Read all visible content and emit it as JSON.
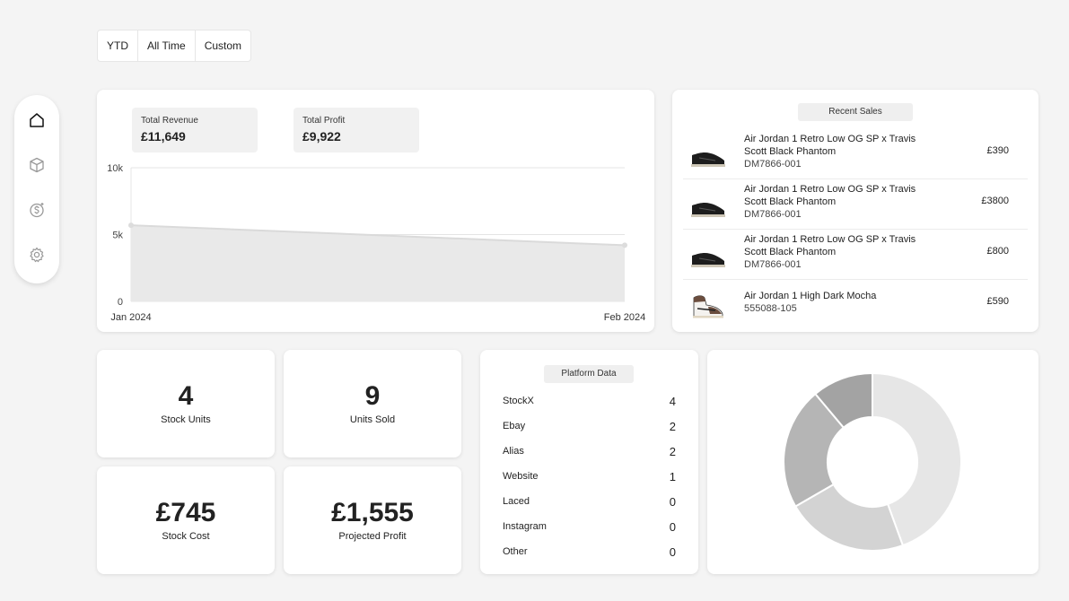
{
  "filters": [
    "YTD",
    "All Time",
    "Custom"
  ],
  "sidebar": {
    "items": [
      {
        "icon": "home-icon"
      },
      {
        "icon": "box-icon"
      },
      {
        "icon": "dollar-coin-icon"
      },
      {
        "icon": "gear-icon"
      }
    ]
  },
  "revenue": {
    "total_revenue_label": "Total Revenue",
    "total_revenue_value": "£11,649",
    "total_profit_label": "Total Profit",
    "total_profit_value": "£9,922"
  },
  "chart_data": {
    "type": "area",
    "x": [
      "Jan 2024",
      "Feb 2024"
    ],
    "values": [
      5700,
      4200
    ],
    "yticks": [
      "0",
      "5k",
      "10k"
    ],
    "ylim": [
      0,
      10000
    ],
    "title": "",
    "xlabel": "",
    "ylabel": "",
    "grid": true,
    "colors": {
      "fill": "#e9e9e9",
      "line": "#dadada",
      "grid": "#e4e4e4"
    }
  },
  "recent_sales": {
    "title": "Recent Sales",
    "items": [
      {
        "name_line1": "Air Jordan 1 Retro Low OG SP x Travis",
        "name_line2": "Scott Black Phantom",
        "sku": "DM7866-001",
        "price": "£390",
        "shoe": "black-low"
      },
      {
        "name_line1": "Air Jordan 1 Retro Low OG SP x Travis",
        "name_line2": "Scott Black Phantom",
        "sku": "DM7866-001",
        "price": "£3800",
        "shoe": "black-low"
      },
      {
        "name_line1": "Air Jordan 1 Retro Low OG SP x Travis",
        "name_line2": "Scott Black Phantom",
        "sku": "DM7866-001",
        "price": "£800",
        "shoe": "black-low"
      },
      {
        "name_line1": "Air Jordan 1 High Dark Mocha",
        "name_line2": "",
        "sku": "555088-105",
        "price": "£590",
        "shoe": "mocha-high"
      }
    ]
  },
  "stats": {
    "stock_units": {
      "value": "4",
      "label": "Stock Units"
    },
    "units_sold": {
      "value": "9",
      "label": "Units Sold"
    },
    "stock_cost": {
      "value": "£745",
      "label": "Stock Cost"
    },
    "projected_profit": {
      "value": "£1,555",
      "label": "Projected Profit"
    }
  },
  "platform": {
    "title": "Platform Data",
    "rows": [
      {
        "name": "StockX",
        "count": "4"
      },
      {
        "name": "Ebay",
        "count": "2"
      },
      {
        "name": "Alias",
        "count": "2"
      },
      {
        "name": "Website",
        "count": "1"
      },
      {
        "name": "Laced",
        "count": "0"
      },
      {
        "name": "Instagram",
        "count": "0"
      },
      {
        "name": "Other",
        "count": "0"
      }
    ]
  },
  "donut_data": {
    "type": "pie",
    "values": [
      4,
      2,
      2,
      1
    ],
    "colors": [
      "#e6e6e6",
      "#d3d3d3",
      "#b5b5b5",
      "#a3a3a3"
    ]
  }
}
